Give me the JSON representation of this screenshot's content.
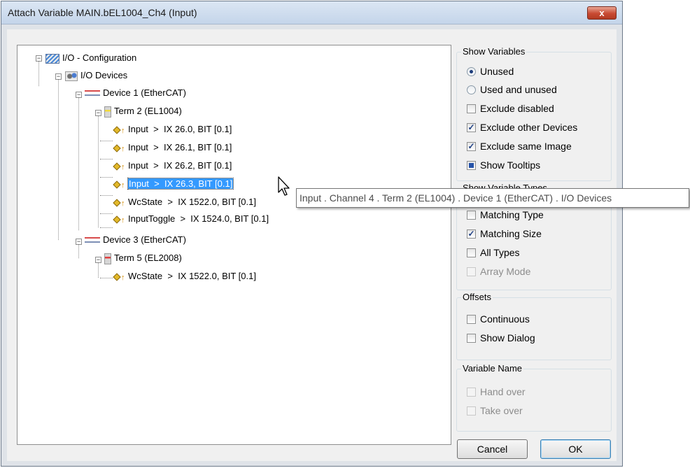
{
  "window": {
    "title": "Attach Variable MAIN.bEL1004_Ch4 (Input)",
    "close_label": "x"
  },
  "tree": {
    "root": "I/O - Configuration",
    "devices": "I/O Devices",
    "device1": "Device 1 (EtherCAT)",
    "term2": "Term 2 (EL1004)",
    "vars1": [
      {
        "name": "Input",
        "addr": "IX 26.0, BIT [0.1]"
      },
      {
        "name": "Input",
        "addr": "IX 26.1, BIT [0.1]"
      },
      {
        "name": "Input",
        "addr": "IX 26.2, BIT [0.1]"
      },
      {
        "name": "Input",
        "addr": "IX 26.3, BIT [0.1]"
      },
      {
        "name": "WcState",
        "addr": "IX 1522.0, BIT [0.1]"
      },
      {
        "name": "InputToggle",
        "addr": "IX 1524.0, BIT [0.1]"
      }
    ],
    "device3": "Device 3 (EtherCAT)",
    "term5": "Term 5 (EL2008)",
    "vars2": [
      {
        "name": "WcState",
        "addr": "IX 1522.0, BIT [0.1]"
      }
    ],
    "sep": ">"
  },
  "tooltip": "Input . Channel 4 . Term 2 (EL1004) . Device 1 (EtherCAT) . I/O Devices",
  "show_variables": {
    "title": "Show Variables",
    "unused": "Unused",
    "used_unused": "Used and unused",
    "exclude_disabled": "Exclude disabled",
    "exclude_other": "Exclude other Devices",
    "exclude_same": "Exclude same Image",
    "show_tooltips": "Show Tooltips"
  },
  "show_types": {
    "title": "Show Variable Types",
    "matching_type": "Matching Type",
    "matching_size": "Matching Size",
    "all_types": "All Types",
    "array_mode": "Array Mode"
  },
  "offsets": {
    "title": "Offsets",
    "continuous": "Continuous",
    "show_dialog": "Show Dialog"
  },
  "variable_name": {
    "title": "Variable Name",
    "hand_over": "Hand over",
    "take_over": "Take over"
  },
  "buttons": {
    "cancel": "Cancel",
    "ok": "OK"
  }
}
